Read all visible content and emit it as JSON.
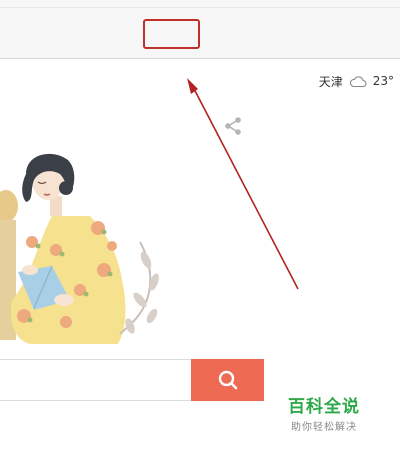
{
  "weather": {
    "city": "天津",
    "temperature": "23°",
    "icon": "cloud-icon"
  },
  "search": {
    "button_icon": "search-icon"
  },
  "toolbar": {
    "highlight": "red-highlight-box"
  },
  "annotation": {
    "arrow_color": "#b22222"
  },
  "watermark": {
    "title": "百科全说",
    "subtitle": "助你轻松解决"
  },
  "colors": {
    "accent": "#ef6a52",
    "watermark_green": "#2fa84a"
  }
}
